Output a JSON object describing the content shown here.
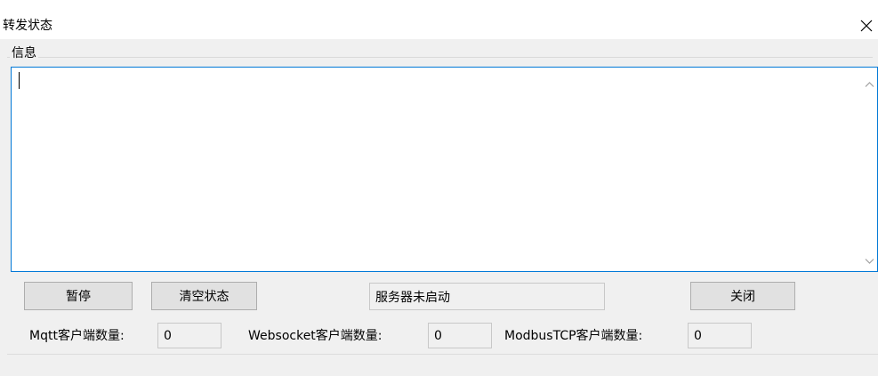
{
  "window": {
    "title": "转发状态",
    "close_icon": "close-icon"
  },
  "info_group": {
    "legend": "信息",
    "log_text": ""
  },
  "toolbar": {
    "pause_label": "暂停",
    "clear_label": "清空状态",
    "server_status": "服务器未启动",
    "close_label": "关闭"
  },
  "stats": {
    "mqtt_label": "Mqtt客户端数量:",
    "mqtt_count": "0",
    "websocket_label": "Websocket客户端数量:",
    "websocket_count": "0",
    "modbus_label": "ModbusTCP客户端数量:",
    "modbus_count": "0"
  }
}
